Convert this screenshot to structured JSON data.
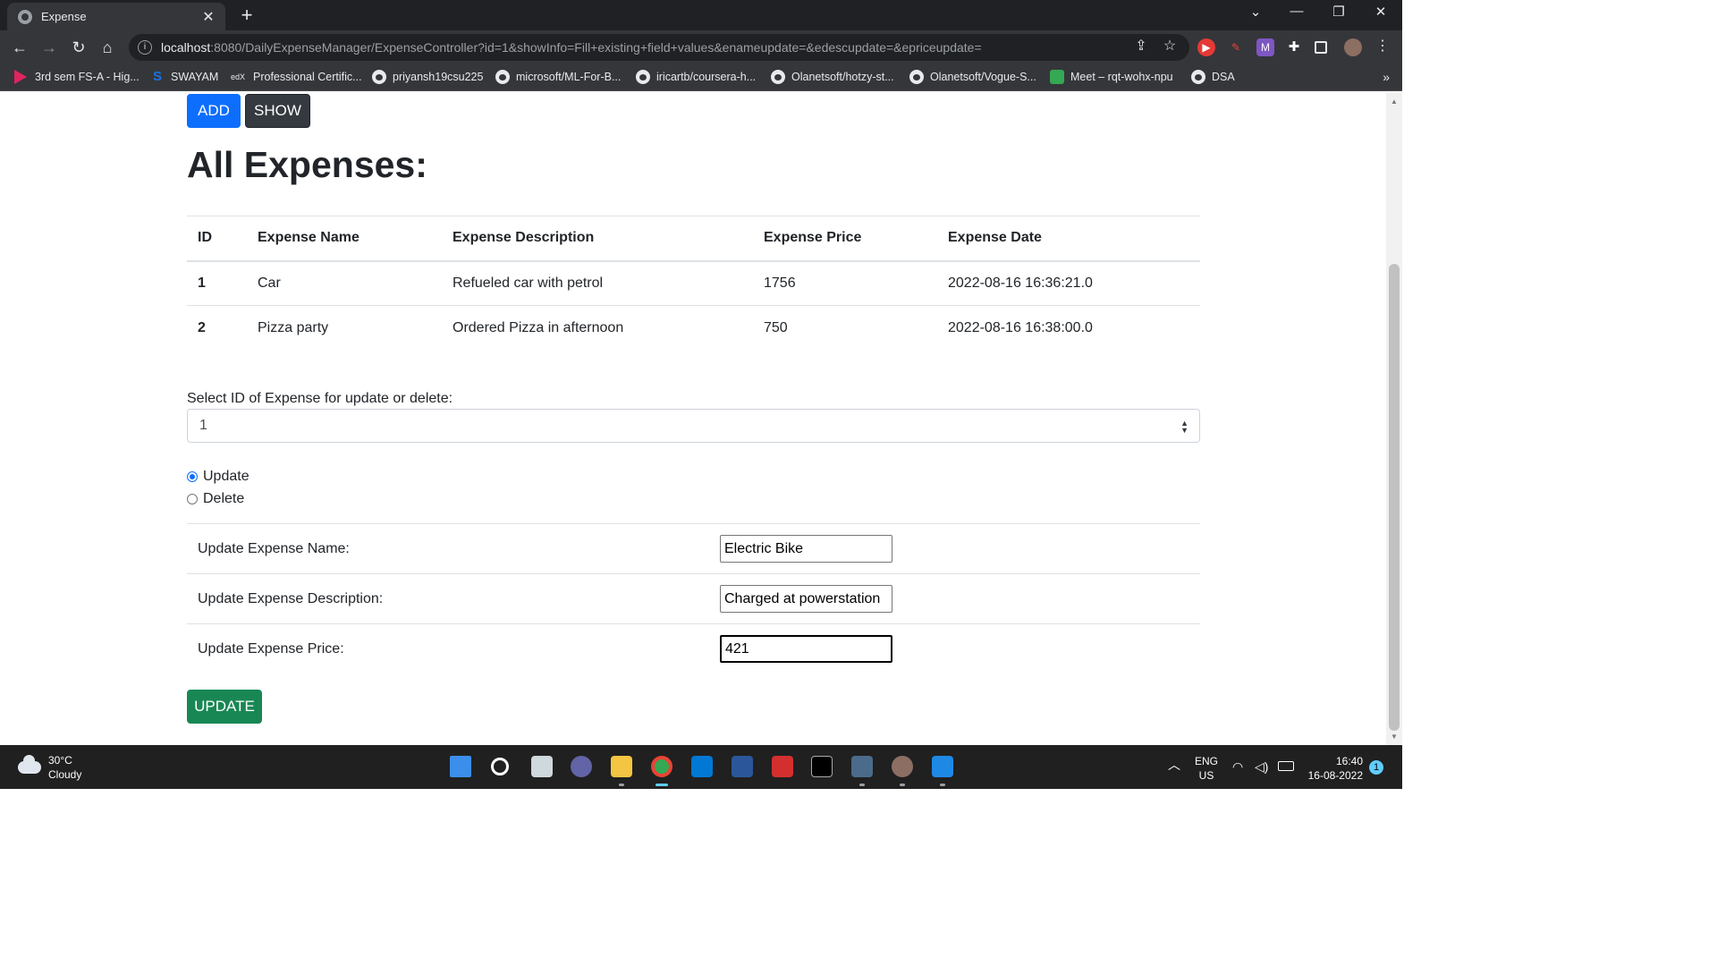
{
  "browser": {
    "tab_title": "Expense",
    "url_host": "localhost",
    "url_rest": ":8080/DailyExpenseManager/ExpenseController?id=1&showInfo=Fill+existing+field+values&enameupdate=&edescupdate=&epriceupdate=",
    "bookmarks": [
      {
        "label": "3rd sem FS-A - Hig...",
        "icon": "youtube-triangle-icon"
      },
      {
        "label": "SWAYAM",
        "icon": "swayam-icon"
      },
      {
        "label": "Professional Certific...",
        "icon": "edx-icon"
      },
      {
        "label": "priyansh19csu225",
        "icon": "github-icon"
      },
      {
        "label": "microsoft/ML-For-B...",
        "icon": "github-icon"
      },
      {
        "label": "iricartb/coursera-h...",
        "icon": "github-icon"
      },
      {
        "label": "Olanetsoft/hotzy-st...",
        "icon": "github-icon"
      },
      {
        "label": "Olanetsoft/Vogue-S...",
        "icon": "github-icon"
      },
      {
        "label": "Meet – rqt-wohx-npu",
        "icon": "meet-icon"
      },
      {
        "label": "DSA",
        "icon": "github-icon"
      }
    ],
    "bookmarks_more": "»"
  },
  "page": {
    "add_label": "ADD",
    "show_label": "SHOW",
    "title": "All Expenses:",
    "table": {
      "headers": [
        "ID",
        "Expense Name",
        "Expense Description",
        "Expense Price",
        "Expense Date"
      ],
      "rows": [
        [
          "1",
          "Car",
          "Refueled car with petrol",
          "1756",
          "2022-08-16 16:36:21.0"
        ],
        [
          "2",
          "Pizza party",
          "Ordered Pizza in afternoon",
          "750",
          "2022-08-16 16:38:00.0"
        ]
      ]
    },
    "select_label": "Select ID of Expense for update or delete:",
    "select_value": "1",
    "radio_update": "Update",
    "radio_delete": "Delete",
    "update_name_label": "Update Expense Name:",
    "update_name_value": "Electric Bike",
    "update_desc_label": "Update Expense Description:",
    "update_desc_value": "Charged at powerstation",
    "update_price_label": "Update Expense Price:",
    "update_price_value": "421",
    "update_button": "UPDATE",
    "colors": {
      "add": "#0d6efd",
      "show": "#343a40",
      "update": "#198754"
    }
  },
  "taskbar": {
    "temperature": "30°C",
    "condition": "Cloudy",
    "lang": "ENG",
    "region": "US",
    "time": "16:40",
    "date": "16-08-2022",
    "notification_count": "1"
  }
}
